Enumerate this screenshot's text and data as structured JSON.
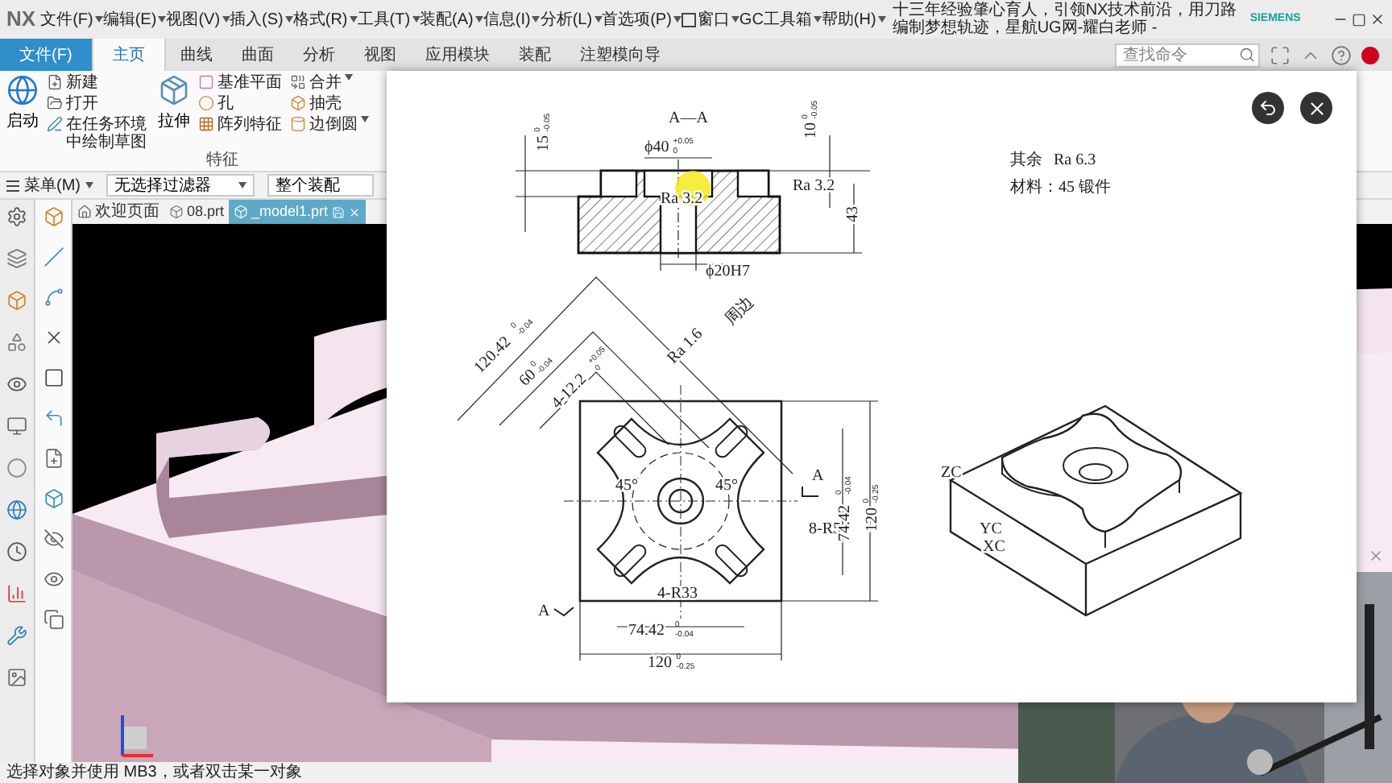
{
  "title_bar": {
    "app_logo": "NX",
    "menus": [
      {
        "label": "文件(F)",
        "kind": "menu"
      },
      {
        "label": "编辑(E)",
        "kind": "menu"
      },
      {
        "label": "视图(V)",
        "kind": "menu"
      },
      {
        "label": "插入(S)",
        "kind": "menu"
      },
      {
        "label": "格式(R)",
        "kind": "menu"
      },
      {
        "label": "工具(T)",
        "kind": "menu"
      },
      {
        "label": "装配(A)",
        "kind": "menu"
      },
      {
        "label": "信息(I)",
        "kind": "menu"
      },
      {
        "label": "分析(L)",
        "kind": "menu"
      },
      {
        "label": "首选项(P)",
        "kind": "menu"
      },
      {
        "label": "窗口",
        "kind": "window"
      },
      {
        "label": "GC工具箱",
        "kind": "menu"
      },
      {
        "label": "帮助(H)",
        "kind": "menu"
      }
    ],
    "title": "十三年经验肇心育人，引领NX技术前沿，用刀路编制梦想轨迹，星航UG网-耀白老师 -",
    "brand": "SIEMENS"
  },
  "ribbon_tabs": [
    {
      "label": "文件(F)",
      "kind": "file",
      "selected": false
    },
    {
      "label": "主页",
      "kind": "tab",
      "selected": true
    },
    {
      "label": "曲线",
      "kind": "tab",
      "selected": false
    },
    {
      "label": "曲面",
      "kind": "tab",
      "selected": false
    },
    {
      "label": "分析",
      "kind": "tab",
      "selected": false
    },
    {
      "label": "视图",
      "kind": "tab",
      "selected": false
    },
    {
      "label": "应用模块",
      "kind": "tab",
      "selected": false
    },
    {
      "label": "装配",
      "kind": "tab",
      "selected": false
    },
    {
      "label": "注塑模向导",
      "kind": "tab",
      "selected": false
    }
  ],
  "command_search": {
    "placeholder": "查找命令"
  },
  "ribbon": {
    "large_start": {
      "label": "启动"
    },
    "file_commands": [
      {
        "label": "新建",
        "kind": "new"
      },
      {
        "label": "打开",
        "kind": "open"
      },
      {
        "label": "在任务环境中绘制草图",
        "kind": "sketch"
      }
    ],
    "large_extrude": {
      "label": "拉伸"
    },
    "feature_commands": [
      {
        "label": "基准平面",
        "kind": "plane"
      },
      {
        "label": "孔",
        "kind": "hole"
      },
      {
        "label": "阵列特征",
        "kind": "pattern"
      }
    ],
    "solid_commands": [
      {
        "label": "合并",
        "kind": "unite"
      },
      {
        "label": "抽壳",
        "kind": "shell"
      },
      {
        "label": "边倒圆",
        "kind": "blend"
      }
    ],
    "group_label": "特征"
  },
  "selection_bar": {
    "menu": "菜单(M)",
    "filter": "无选择过滤器",
    "scope": "整个装配"
  },
  "document_tabs": [
    {
      "label": "欢迎页面",
      "kind": "home",
      "selected": false
    },
    {
      "label": "08.prt",
      "kind": "part",
      "selected": false
    },
    {
      "label": "_model1.prt",
      "kind": "part",
      "selected": true
    }
  ],
  "image_viewer": {
    "drawing": {
      "labels": [
        {
          "text": "A—A"
        },
        {
          "text": "15",
          "upper": "0",
          "lower": "-0.05"
        },
        {
          "text": "ϕ40",
          "upper": "+0.05",
          "lower": "0"
        },
        {
          "text": "10",
          "upper": "0",
          "lower": "-0.05"
        },
        {
          "text": "Ra 3.2"
        },
        {
          "text": "Ra 3.2"
        },
        {
          "text": "43"
        },
        {
          "text": "ϕ20H7"
        },
        {
          "text": "120.42",
          "upper": "0",
          "lower": "-0.04"
        },
        {
          "text": "60",
          "upper": "0",
          "lower": "-0.04"
        },
        {
          "text": "4-12.2",
          "upper": "+0.05",
          "lower": "0"
        },
        {
          "text": "Ra 1.6"
        },
        {
          "text": "周边"
        },
        {
          "text": "45°"
        },
        {
          "text": "45°"
        },
        {
          "text": "A"
        },
        {
          "text": "8-R5"
        },
        {
          "text": "74.42",
          "upper": "0",
          "lower": "-0.04"
        },
        {
          "text": "120",
          "upper": "0",
          "lower": "-0.25"
        },
        {
          "text": "4-R33"
        },
        {
          "text": "A"
        },
        {
          "text": "74.42",
          "upper": "0",
          "lower": "-0.04"
        },
        {
          "text": "120",
          "upper": "0",
          "lower": "-0.25"
        },
        {
          "text": "其余"
        },
        {
          "text": "Ra 6.3"
        },
        {
          "text": "材料：45 锻件"
        },
        {
          "text": "ZC"
        },
        {
          "text": "YC"
        },
        {
          "text": "XC"
        }
      ]
    }
  },
  "status_bar": "选择对象并使用 MB3，或者双击某一对象"
}
